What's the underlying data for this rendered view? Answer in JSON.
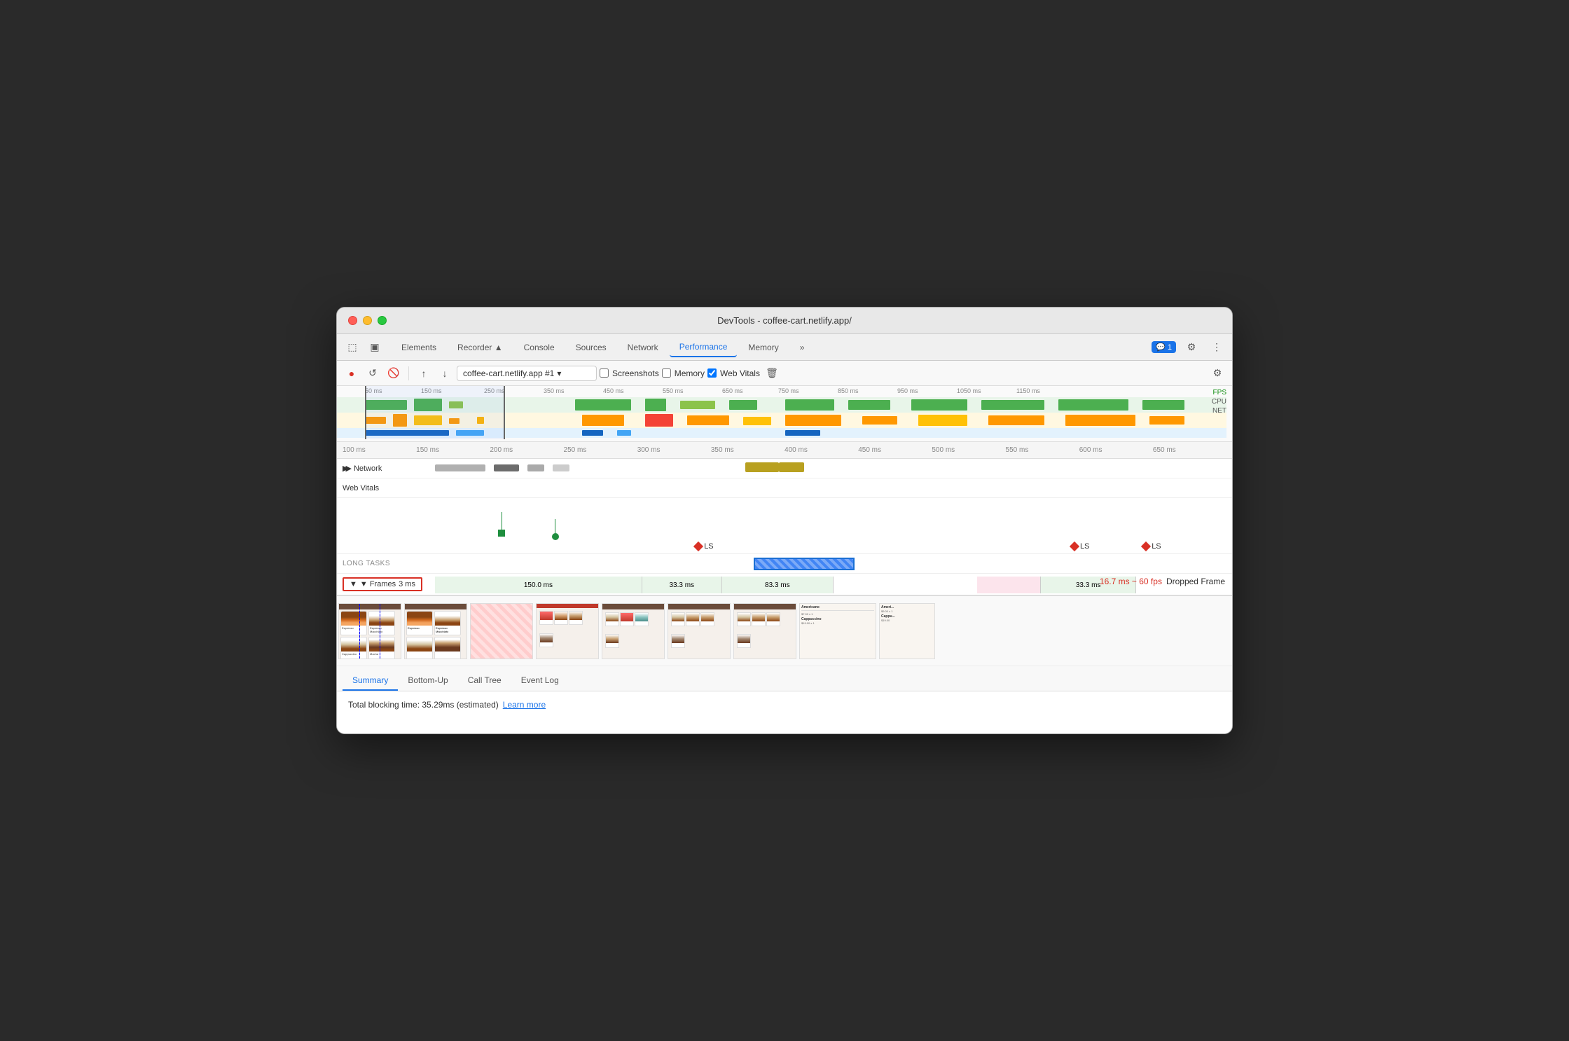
{
  "window": {
    "title": "DevTools - coffee-cart.netlify.app/"
  },
  "traffic_lights": {
    "close": "close",
    "minimize": "minimize",
    "maximize": "maximize"
  },
  "tabs": {
    "items": [
      {
        "label": "Elements",
        "active": false
      },
      {
        "label": "Recorder ▲",
        "active": false
      },
      {
        "label": "Console",
        "active": false
      },
      {
        "label": "Sources",
        "active": false
      },
      {
        "label": "Network",
        "active": false
      },
      {
        "label": "Performance",
        "active": true
      },
      {
        "label": "Memory",
        "active": false
      },
      {
        "label": "»",
        "active": false
      }
    ],
    "badge": "1",
    "gear_label": "⚙",
    "more_label": "⋮"
  },
  "toolbar": {
    "record_label": "●",
    "reload_label": "↺",
    "clear_label": "🚫",
    "upload_label": "↑",
    "download_label": "↓",
    "url_value": "coffee-cart.netlify.app #1",
    "screenshots_label": "Screenshots",
    "memory_label": "Memory",
    "web_vitals_label": "Web Vitals",
    "trash_label": "🗑",
    "gear_label": "⚙"
  },
  "overview": {
    "time_marks": [
      "50 ms",
      "150 ms",
      "250 ms",
      "350 ms",
      "450 ms",
      "550 ms",
      "650 ms",
      "750 ms",
      "850 ms",
      "950 ms",
      "1050 ms",
      "1150 ms"
    ],
    "fps_label": "FPS",
    "cpu_label": "CPU",
    "net_label": "NET"
  },
  "ruler": {
    "marks": [
      "100 ms",
      "150 ms",
      "200 ms",
      "250 ms",
      "300 ms",
      "350 ms",
      "400 ms",
      "450 ms",
      "500 ms",
      "550 ms",
      "600 ms",
      "650 ms"
    ]
  },
  "tracks": {
    "network_label": "▶ Network",
    "web_vitals_label": "Web Vitals",
    "long_tasks_label": "LONG TASKS",
    "frames_label": "▼ Frames",
    "frames_time": "3 ms"
  },
  "frames": {
    "segments": [
      {
        "label": "150.0 ms",
        "type": "green"
      },
      {
        "label": "33.3 ms",
        "type": "green"
      },
      {
        "label": "83.3 ms",
        "type": "green"
      },
      {
        "label": "33.3 ms",
        "type": "pink"
      }
    ],
    "dropped_info": "16.7 ms ~ 60 fps",
    "dropped_label": "Dropped Frame"
  },
  "ls_markers": [
    {
      "label": "LS",
      "position": "40%"
    },
    {
      "label": "LS",
      "position": "82%"
    },
    {
      "label": "LS",
      "position": "90%"
    }
  ],
  "bottom_tabs": {
    "items": [
      {
        "label": "Summary",
        "active": true
      },
      {
        "label": "Bottom-Up",
        "active": false
      },
      {
        "label": "Call Tree",
        "active": false
      },
      {
        "label": "Event Log",
        "active": false
      }
    ]
  },
  "summary": {
    "blocking_time": "Total blocking time: 35.29ms (estimated)",
    "learn_more": "Learn more"
  }
}
